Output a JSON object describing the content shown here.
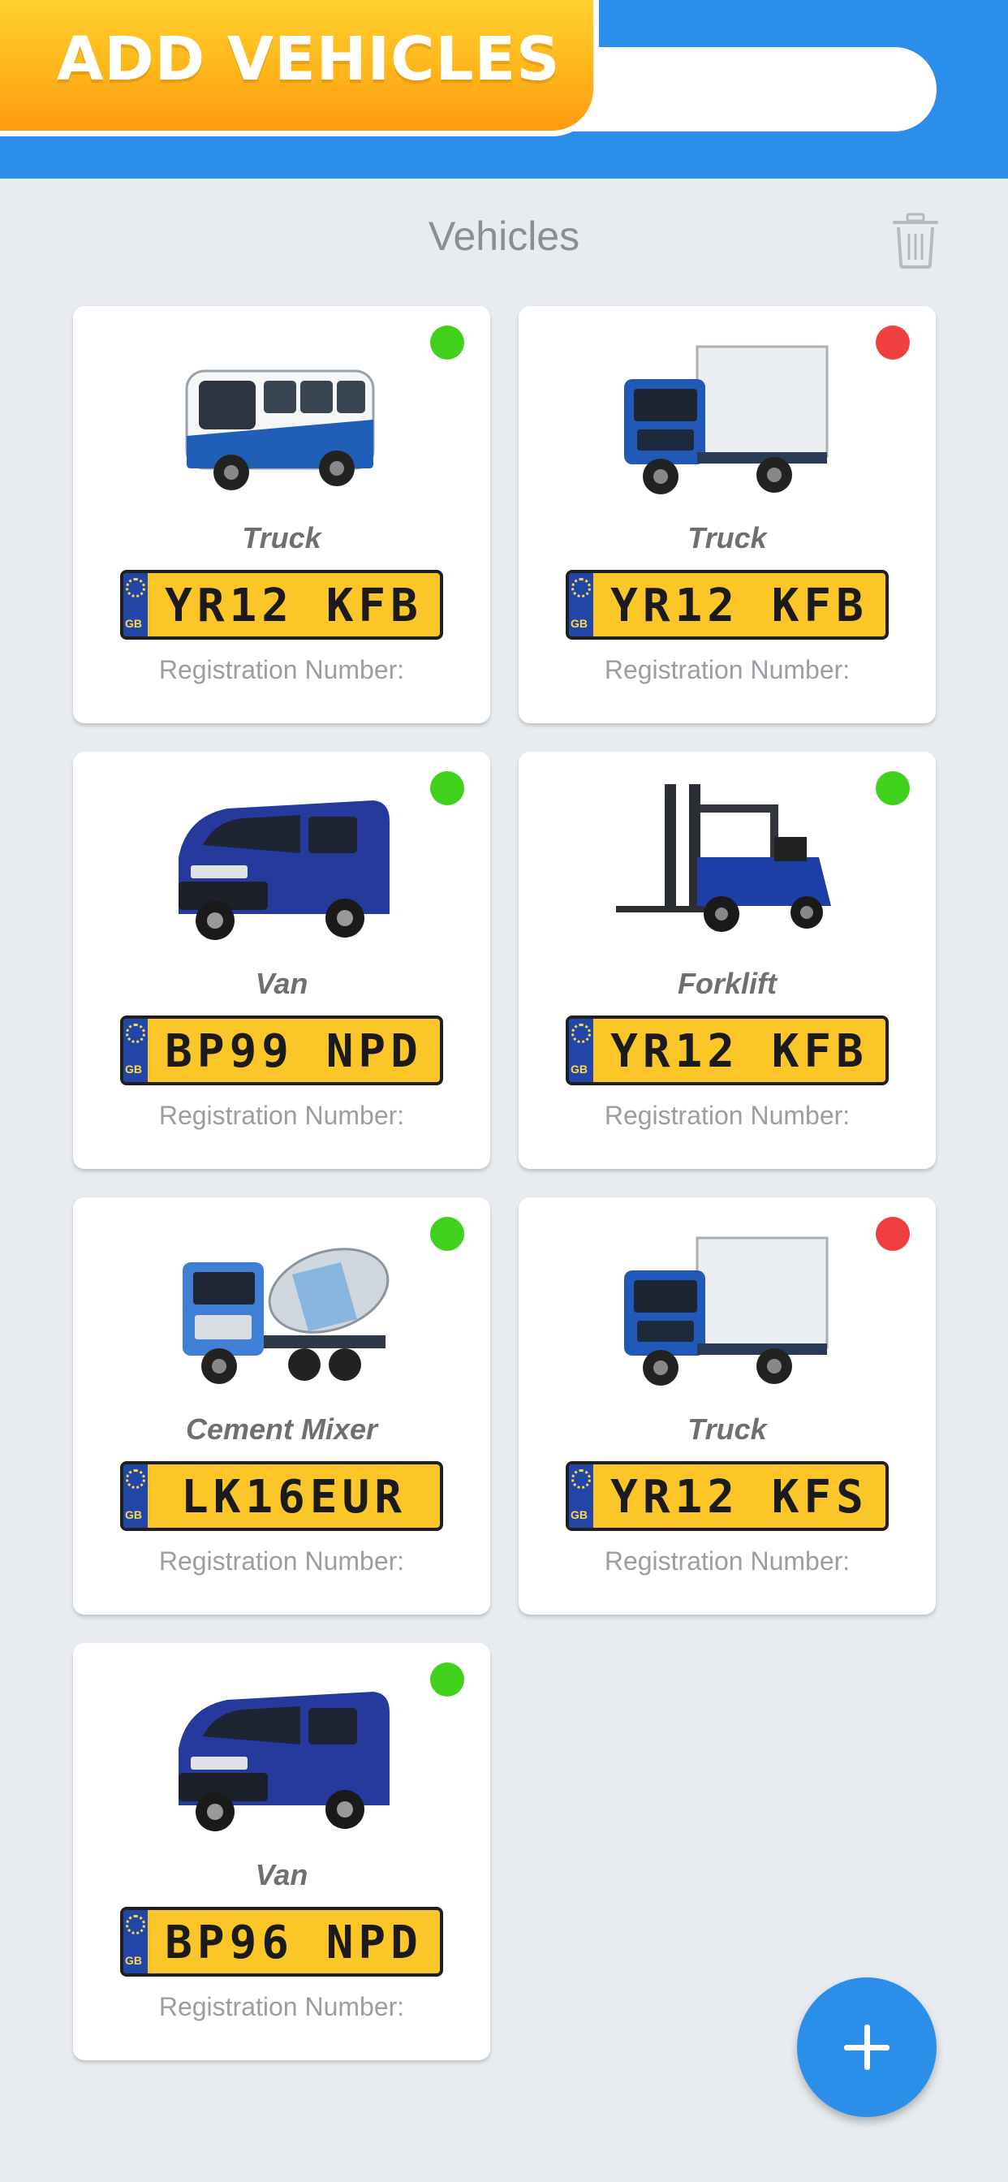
{
  "header": {
    "title": "ADD VEHICLES",
    "search_value": ""
  },
  "section": {
    "title": "Vehicles",
    "delete_icon": "trash-icon"
  },
  "colors": {
    "accent": "#2b8ee8",
    "status_active": "#3fd11c",
    "status_inactive": "#ef3f3f",
    "plate_yellow": "#fcc628"
  },
  "vehicles": [
    {
      "type": "Truck",
      "plate": "YR12 KFB",
      "reg_label": "Registration Number:",
      "status": "active",
      "image": "bus-image"
    },
    {
      "type": "Truck",
      "plate": "YR12 KFB",
      "reg_label": "Registration Number:",
      "status": "inactive",
      "image": "box-truck-image"
    },
    {
      "type": "Van",
      "plate": "BP99 NPD",
      "reg_label": "Registration Number:",
      "status": "active",
      "image": "van-image"
    },
    {
      "type": "Forklift",
      "plate": "YR12 KFB",
      "reg_label": "Registration Number:",
      "status": "active",
      "image": "forklift-image"
    },
    {
      "type": "Cement Mixer",
      "plate": "LK16EUR",
      "reg_label": "Registration Number:",
      "status": "active",
      "image": "cement-mixer-image"
    },
    {
      "type": "Truck",
      "plate": "YR12 KFS",
      "reg_label": "Registration Number:",
      "status": "inactive",
      "image": "box-truck-image"
    },
    {
      "type": "Van",
      "plate": "BP96 NPD",
      "reg_label": "Registration Number:",
      "status": "active",
      "image": "van-image"
    }
  ],
  "plate_country": "GB",
  "fab": {
    "icon": "plus-icon"
  }
}
